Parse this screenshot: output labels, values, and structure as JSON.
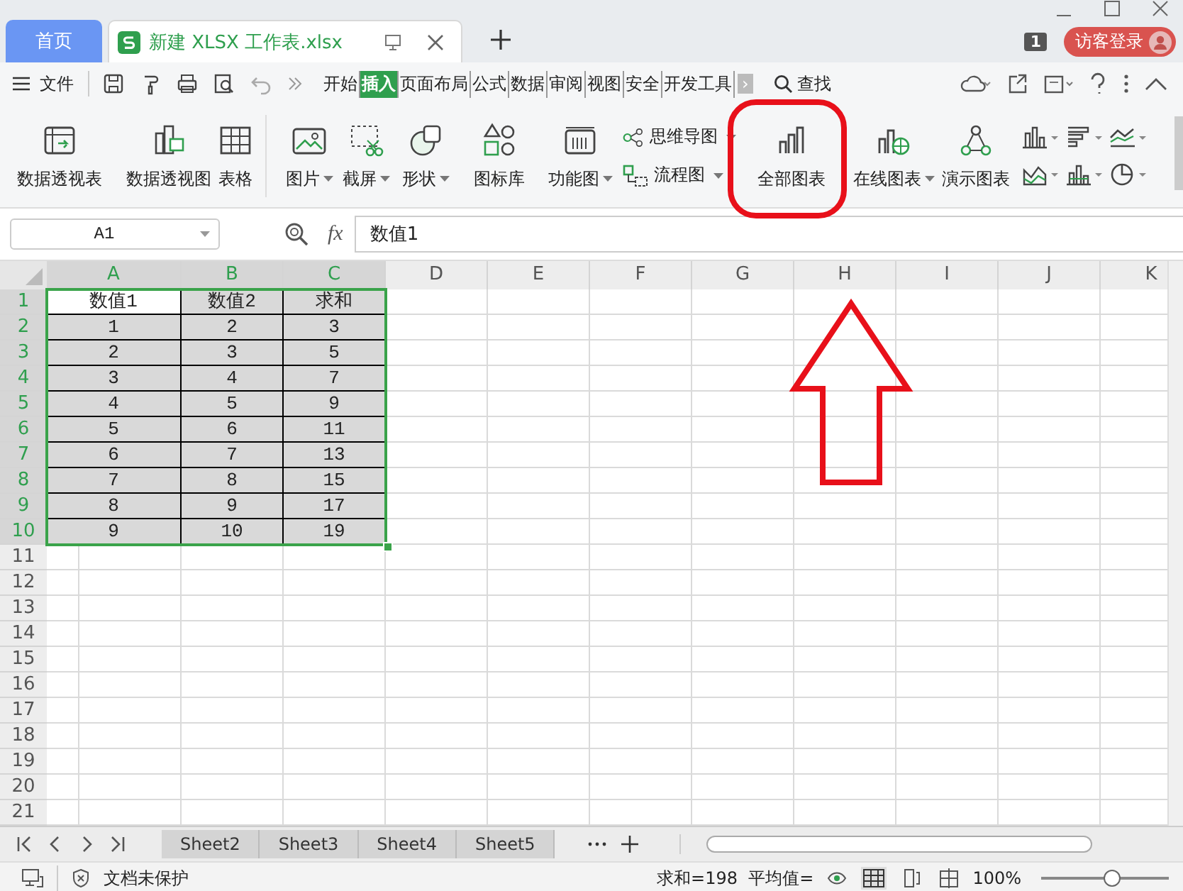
{
  "window": {
    "tabs": [
      {
        "label": "首页",
        "kind": "home",
        "selected": false
      },
      {
        "label": "新建 XLSX 工作表.xlsx",
        "kind": "doc",
        "selected": true
      }
    ],
    "badge": "1",
    "login": "访客登录"
  },
  "menu": {
    "file": "文件",
    "tabs": [
      {
        "label": "开始",
        "selected": false
      },
      {
        "label": "插入",
        "selected": true
      },
      {
        "label": "页面布局",
        "selected": false
      },
      {
        "label": "公式",
        "selected": false
      },
      {
        "label": "数据",
        "selected": false
      },
      {
        "label": "审阅",
        "selected": false
      },
      {
        "label": "视图",
        "selected": false
      },
      {
        "label": "安全",
        "selected": false
      },
      {
        "label": "开发工具",
        "selected": false
      }
    ],
    "more": "›",
    "search": "查找"
  },
  "ribbon": [
    {
      "kind": "large",
      "label": "数据透视表",
      "dropdown": false
    },
    {
      "kind": "large",
      "label": "数据透视图",
      "dropdown": false
    },
    {
      "kind": "large",
      "label": "表格",
      "dropdown": false
    },
    {
      "kind": "large",
      "label": "图片",
      "dropdown": true
    },
    {
      "kind": "large",
      "label": "截屏",
      "dropdown": true
    },
    {
      "kind": "large",
      "label": "形状",
      "dropdown": true
    },
    {
      "kind": "large",
      "label": "图标库",
      "dropdown": false
    },
    {
      "kind": "large",
      "label": "功能图",
      "dropdown": true
    },
    {
      "kind": "pair",
      "items": [
        {
          "label": "思维导图",
          "dropdown": true
        },
        {
          "label": "流程图",
          "dropdown": true
        }
      ]
    },
    {
      "kind": "large",
      "label": "全部图表",
      "dropdown": false
    },
    {
      "kind": "large",
      "label": "在线图表",
      "dropdown": true
    },
    {
      "kind": "large",
      "label": "演示图表",
      "dropdown": false
    },
    {
      "kind": "icons"
    }
  ],
  "formula_bar": {
    "cell": "A1",
    "fx": "fx",
    "value": "数值1"
  },
  "sheet": {
    "columns": [
      {
        "label": "A",
        "selected": true
      },
      {
        "label": "B",
        "selected": true
      },
      {
        "label": "C",
        "selected": true
      },
      {
        "label": "D",
        "selected": false
      },
      {
        "label": "E",
        "selected": false
      },
      {
        "label": "F",
        "selected": false
      },
      {
        "label": "G",
        "selected": false
      },
      {
        "label": "H",
        "selected": false
      },
      {
        "label": "I",
        "selected": false
      },
      {
        "label": "J",
        "selected": false
      },
      {
        "label": "K",
        "selected": false
      }
    ],
    "rows": [
      {
        "number": "1",
        "selected": true,
        "cells": [
          {
            "text": "数值1",
            "active": true
          },
          {
            "text": "数值2",
            "active": false
          },
          {
            "text": "求和",
            "active": false
          }
        ]
      },
      {
        "number": "2",
        "selected": true,
        "cells": [
          {
            "text": "1",
            "active": false
          },
          {
            "text": "2",
            "active": false
          },
          {
            "text": "3",
            "active": false
          }
        ]
      },
      {
        "number": "3",
        "selected": true,
        "cells": [
          {
            "text": "2",
            "active": false
          },
          {
            "text": "3",
            "active": false
          },
          {
            "text": "5",
            "active": false
          }
        ]
      },
      {
        "number": "4",
        "selected": true,
        "cells": [
          {
            "text": "3",
            "active": false
          },
          {
            "text": "4",
            "active": false
          },
          {
            "text": "7",
            "active": false
          }
        ]
      },
      {
        "number": "5",
        "selected": true,
        "cells": [
          {
            "text": "4",
            "active": false
          },
          {
            "text": "5",
            "active": false
          },
          {
            "text": "9",
            "active": false
          }
        ]
      },
      {
        "number": "6",
        "selected": true,
        "cells": [
          {
            "text": "5",
            "active": false
          },
          {
            "text": "6",
            "active": false
          },
          {
            "text": "11",
            "active": false
          }
        ]
      },
      {
        "number": "7",
        "selected": true,
        "cells": [
          {
            "text": "6",
            "active": false
          },
          {
            "text": "7",
            "active": false
          },
          {
            "text": "13",
            "active": false
          }
        ]
      },
      {
        "number": "8",
        "selected": true,
        "cells": [
          {
            "text": "7",
            "active": false
          },
          {
            "text": "8",
            "active": false
          },
          {
            "text": "15",
            "active": false
          }
        ]
      },
      {
        "number": "9",
        "selected": true,
        "cells": [
          {
            "text": "8",
            "active": false
          },
          {
            "text": "9",
            "active": false
          },
          {
            "text": "17",
            "active": false
          }
        ]
      },
      {
        "number": "10",
        "selected": true,
        "cells": [
          {
            "text": "9",
            "active": false
          },
          {
            "text": "10",
            "active": false
          },
          {
            "text": "19",
            "active": false
          }
        ]
      },
      {
        "number": "11",
        "selected": false
      },
      {
        "number": "12",
        "selected": false
      },
      {
        "number": "13",
        "selected": false
      },
      {
        "number": "14",
        "selected": false
      },
      {
        "number": "15",
        "selected": false
      },
      {
        "number": "16",
        "selected": false
      },
      {
        "number": "17",
        "selected": false
      },
      {
        "number": "18",
        "selected": false
      },
      {
        "number": "19",
        "selected": false
      },
      {
        "number": "20",
        "selected": false
      },
      {
        "number": "21",
        "selected": false
      }
    ]
  },
  "sheet_tabs": [
    {
      "label": "Sheet2",
      "selected": false
    },
    {
      "label": "Sheet3",
      "selected": false
    },
    {
      "label": "Sheet4",
      "selected": false
    },
    {
      "label": "Sheet5",
      "selected": false
    }
  ],
  "status_bar": {
    "protection": "文档未保护",
    "summary": "求和=198  平均值=",
    "zoom": "100%",
    "zoom_slider": {
      "level": 0.55
    }
  }
}
